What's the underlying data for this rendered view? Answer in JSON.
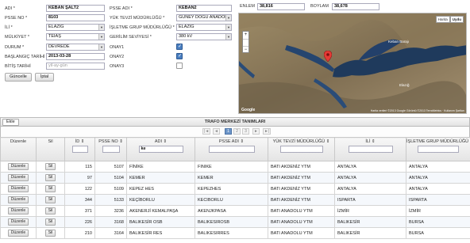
{
  "form": {
    "adi_label": "ADI *",
    "adi_value": "KEBAN ŞALT2",
    "psse_no_label": "PSSE NO *",
    "psse_no_value": "8103",
    "il_label": "İLİ *",
    "il_value": "ELAZIĞ",
    "mulkiyet_label": "MÜLKİYET *",
    "mulkiyet_value": "TEİAŞ",
    "durum_label": "DURUM *",
    "durum_value": "DEVREDE",
    "baslangic_label": "BAŞLANGIÇ TARİHİ",
    "baslangic_value": "2013-03-28",
    "bitis_label": "BİTİŞ TARİHİ",
    "bitis_placeholder": "yil-ay-gün",
    "psse_adi_label": "PSSE ADI *",
    "psse_adi_value": "KEBAN2",
    "yuk_tevzi_label": "YÜK TEVZİ MÜDÜRLÜĞÜ *",
    "yuk_tevzi_value": "GÜNEY DOĞU ANADOLU",
    "isletme_label": "İŞLETME GRUP MÜDÜRLÜĞÜ *",
    "isletme_value": "ELAZIĞ",
    "gerilim_label": "GERİLİM SEVİYESİ *",
    "gerilim_value": "380 kV",
    "onay1_label": "ONAY1",
    "onay1_checked": true,
    "onay2_label": "ONAY2",
    "onay2_checked": true,
    "onay3_label": "ONAY3",
    "onay3_checked": false,
    "guncelle_label": "Güncelle",
    "iptal_label": "İptal"
  },
  "map": {
    "enlem_label": "ENLEM",
    "enlem_value": "38,816",
    "boylam_label": "BOYLAM",
    "boylam_value": "38,678",
    "tab_map": "Harita",
    "tab_sat": "Uydu",
    "place1": "Keban Barajı",
    "place2": "Elazığ",
    "footer": "Harita verileri ©2013 Google Görüntü ©2013 TerraMetrics · Kullanım Şartları",
    "logo": "Google",
    "marker_color": "#e53935"
  },
  "grid": {
    "ekle_label": "Ekle",
    "title": "TRAFO MERKEZİ TANIMLARI",
    "pages": [
      "1",
      "2",
      "3"
    ],
    "pager_first": "|◄",
    "pager_prev": "◄",
    "pager_next": "►",
    "pager_last": "►|",
    "headers": {
      "duzenle": "Düzenle",
      "sil": "Sil",
      "id": "İD",
      "psse_no": "PSSE NO",
      "adi": "ADI",
      "psse_adi": "PSSE ADI",
      "yuk_tevzi": "YÜK TEVZİ MÜDÜRLÜĞÜ",
      "il": "İLİ",
      "isletme": "İŞLETME GRUP MÜDÜRLÜĞÜ"
    },
    "filter_adi": "ke",
    "duzenle_btn": "Düzenle",
    "sil_btn": "Sil",
    "rows": [
      {
        "id": "115",
        "psse_no": "5107",
        "adi": "FİNİKE",
        "psse_adi": "FINIKE",
        "yuk": "BATI AKDENİZ YTM",
        "il": "ANTALYA",
        "isl": "ANTALYA"
      },
      {
        "id": "97",
        "psse_no": "5104",
        "adi": "KEMER",
        "psse_adi": "KEMER",
        "yuk": "BATI AKDENİZ YTM",
        "il": "ANTALYA",
        "isl": "ANTALYA"
      },
      {
        "id": "122",
        "psse_no": "5109",
        "adi": "KEPEZ HES",
        "psse_adi": "KEPEZHES",
        "yuk": "BATI AKDENİZ YTM",
        "il": "ANTALYA",
        "isl": "ANTALYA"
      },
      {
        "id": "344",
        "psse_no": "5133",
        "adi": "KEÇİBORLU",
        "psse_adi": "KECIBORLU",
        "yuk": "BATI AKDENİZ YTM",
        "il": "ISPARTA",
        "isl": "ISPARTA"
      },
      {
        "id": "371",
        "psse_no": "3236",
        "adi": "AKENERJİ KEMALPAŞA",
        "psse_adi": "AKENJKPASA",
        "yuk": "BATI ANADOLU YTM",
        "il": "İZMİR",
        "isl": "İZMİR"
      },
      {
        "id": "226",
        "psse_no": "3168",
        "adi": "BALIKESİR OSB",
        "psse_adi": "BALIKESIROSB",
        "yuk": "BATI ANADOLU YTM",
        "il": "BALIKESİR",
        "isl": "BURSA"
      },
      {
        "id": "210",
        "psse_no": "3164",
        "adi": "BALIKESİR RES",
        "psse_adi": "BALIKESIRRES",
        "yuk": "BATI ANADOLU YTM",
        "il": "BALIKESİR",
        "isl": "BURSA"
      }
    ]
  }
}
